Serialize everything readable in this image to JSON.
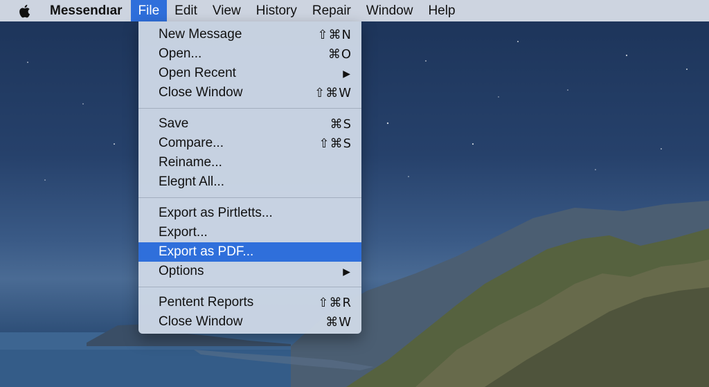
{
  "menubar": {
    "app_name": "Messendıar",
    "items": [
      {
        "label": "File",
        "active": true
      },
      {
        "label": "Edit"
      },
      {
        "label": "View"
      },
      {
        "label": "History"
      },
      {
        "label": "Repair"
      },
      {
        "label": "Window"
      },
      {
        "label": "Help"
      }
    ]
  },
  "file_menu": {
    "groups": [
      [
        {
          "label": "New Message",
          "shortcut": "⇧⌘N"
        },
        {
          "label": "Open...",
          "shortcut": "⌘O"
        },
        {
          "label": "Open Recent",
          "submenu": true
        },
        {
          "label": "Close Window",
          "shortcut": "⇧⌘W"
        }
      ],
      [
        {
          "label": "Save",
          "shortcut": "⌘S"
        },
        {
          "label": "Compare...",
          "shortcut": "⇧⌘S"
        },
        {
          "label": "Reiname..."
        },
        {
          "label": "Elegnt All..."
        }
      ],
      [
        {
          "label": "Export as Pirtletts..."
        },
        {
          "label": "Export..."
        },
        {
          "label": "Export as PDF...",
          "highlighted": true
        },
        {
          "label": "Options",
          "submenu": true
        }
      ],
      [
        {
          "label": "Pentent Reports",
          "shortcut": "⇧⌘R"
        },
        {
          "label": "Close Window",
          "shortcut": "⌘W"
        }
      ]
    ],
    "submenu_arrow": "▶",
    "highlight_color": "#2f6fdb"
  },
  "icons": {
    "apple": "apple-logo-icon",
    "submenu": "triangle-right-icon"
  }
}
